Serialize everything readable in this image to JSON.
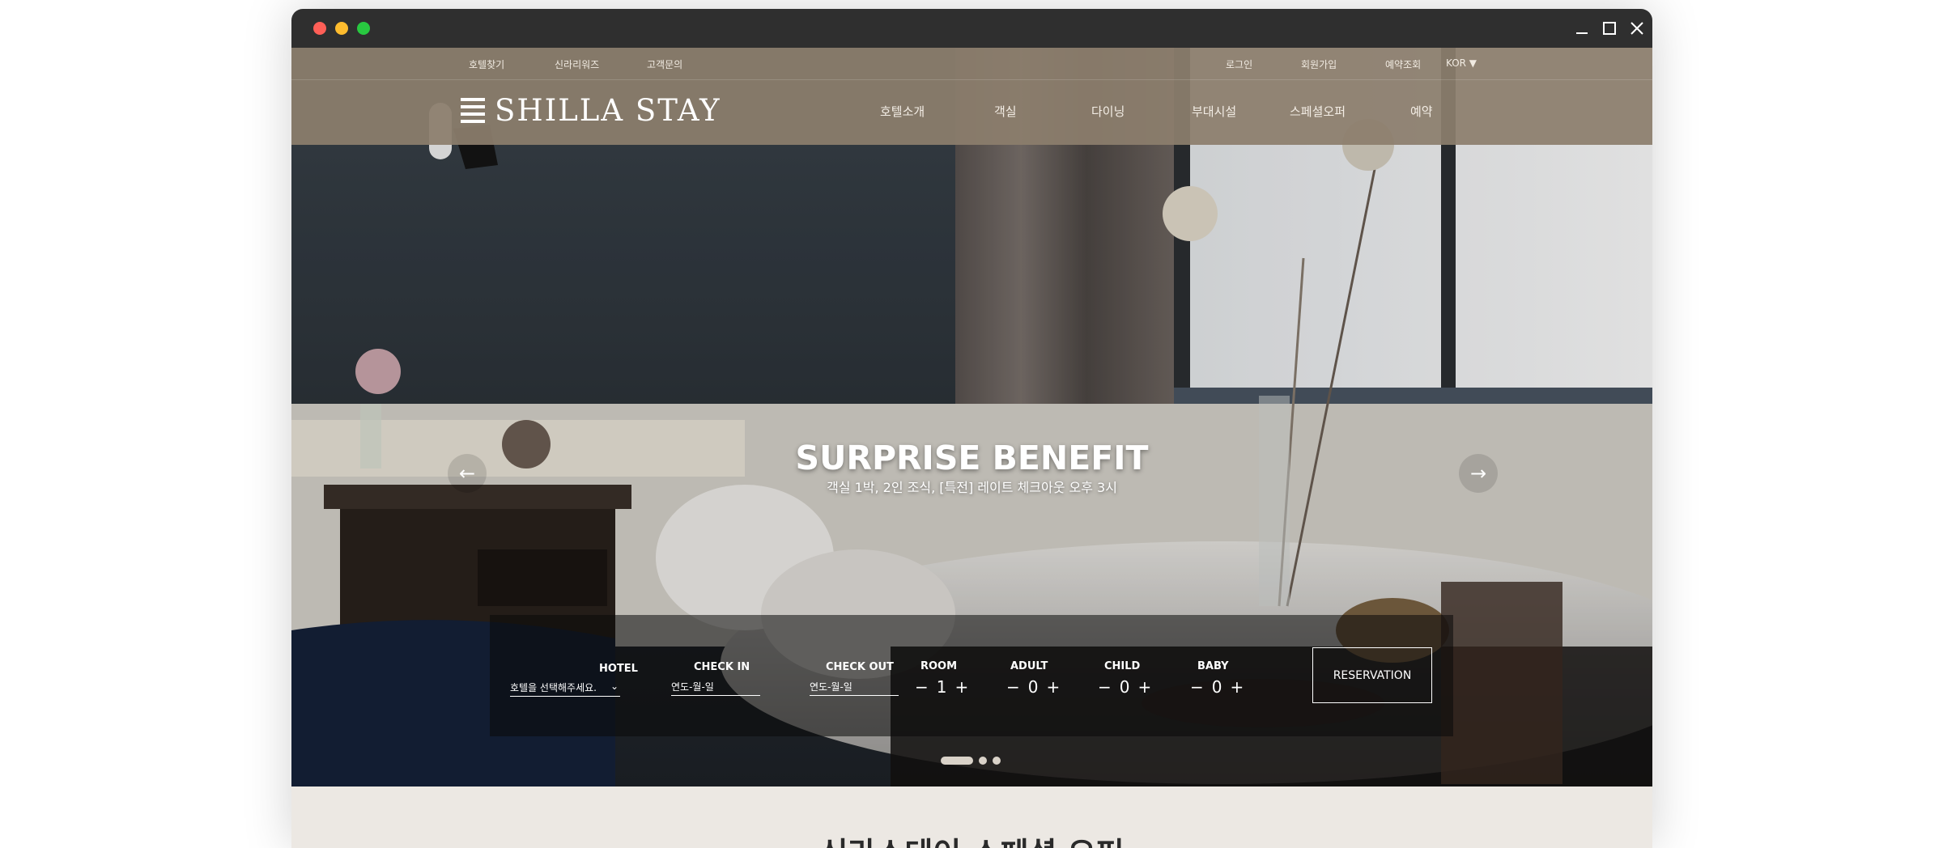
{
  "util_nav": {
    "left": [
      "호텔찾기",
      "신라리워즈",
      "고객문의"
    ],
    "right": [
      "로그인",
      "회원가입",
      "예약조회"
    ],
    "language": "KOR ▼"
  },
  "logo": {
    "text": "SHILLA STAY"
  },
  "main_menu": [
    "호텔소개",
    "객실",
    "다이닝",
    "부대시설",
    "스페셜오퍼",
    "예약"
  ],
  "slide": {
    "title": "SURPRISE BENEFIT",
    "subtitle": "객실 1박, 2인 조식, [특전] 레이트 체크아웃 오후 3시",
    "prev_arrow": "←",
    "next_arrow": "→",
    "active_index": 1,
    "total": 3
  },
  "booking": {
    "hotel_label": "HOTEL",
    "hotel_value": "호텔을 선택해주세요.",
    "checkin_label": "CHECK IN",
    "checkin_value": "연도-월-일",
    "checkout_label": "CHECK OUT",
    "checkout_value": "연도-월-일",
    "room_label": "ROOM",
    "room_value": "1",
    "adult_label": "ADULT",
    "adult_value": "0",
    "child_label": "CHILD",
    "child_value": "0",
    "baby_label": "BABY",
    "baby_value": "0",
    "minus": "−",
    "plus": "+",
    "reserve_label": "RESERVATION"
  },
  "section": {
    "title": "신라스테이 스페셜 오퍼"
  },
  "colors": {
    "header_bg": "#8c7e6d",
    "titlebar": "#2f2f2f",
    "offer_bg": "#ece8e3"
  }
}
